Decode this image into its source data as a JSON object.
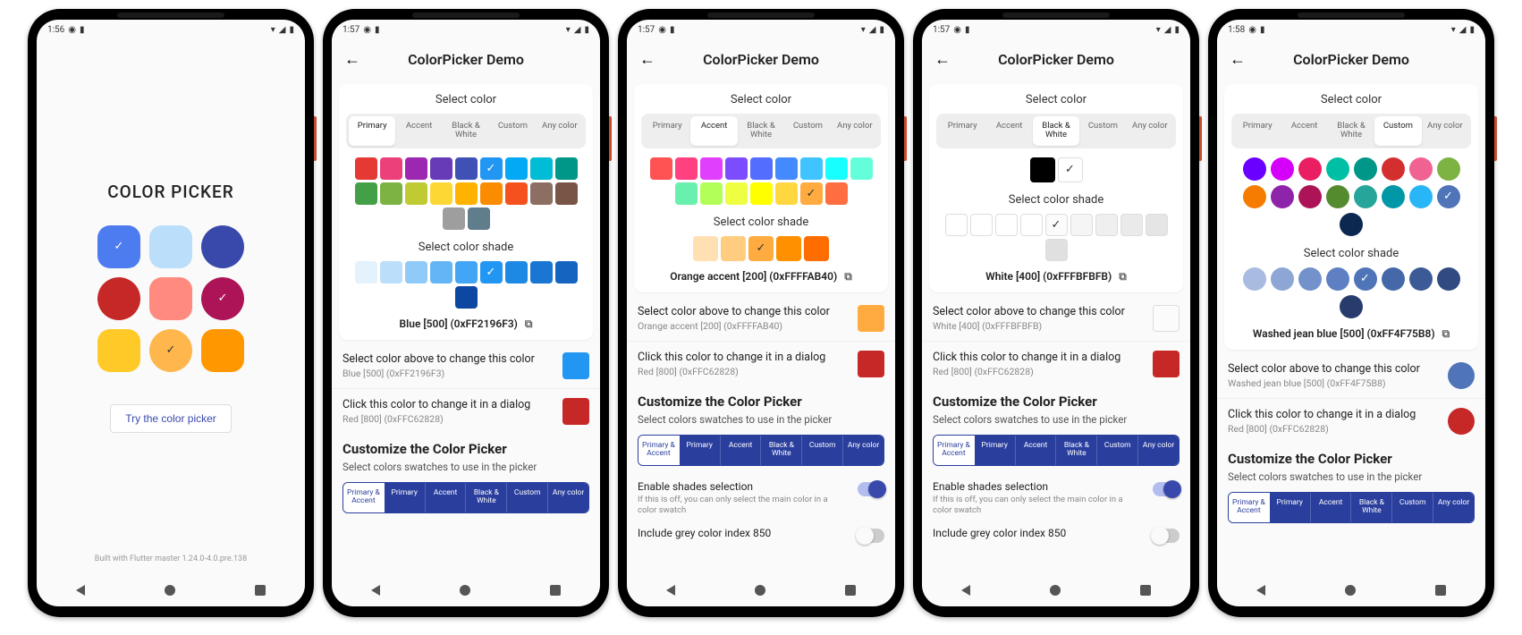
{
  "statusbar_times": [
    "1:56",
    "1:57",
    "1:57",
    "1:57",
    "1:58"
  ],
  "appbar": {
    "title": "ColorPicker Demo"
  },
  "home": {
    "title": "COLOR PICKER",
    "button": "Try the color picker",
    "footer": "Built with Flutter master 1.24.0-4.0.pre.138",
    "swatches": [
      {
        "color": "#4d7cf0",
        "shape": "rounded",
        "check": "light",
        "selected": true
      },
      {
        "color": "#bbdefb",
        "shape": "rounded"
      },
      {
        "color": "#3949ab",
        "shape": "circle"
      },
      {
        "color": "#c62828",
        "shape": "circle"
      },
      {
        "color": "#ff8a80",
        "shape": "rounded"
      },
      {
        "color": "#ad1457",
        "shape": "circle",
        "check": "light",
        "selected": true
      },
      {
        "color": "#ffca28",
        "shape": "rounded"
      },
      {
        "color": "#ffb74d",
        "shape": "circle",
        "check": "dark",
        "selected": true
      },
      {
        "color": "#ff9800",
        "shape": "rounded"
      }
    ]
  },
  "tabs": [
    "Primary",
    "Accent",
    "Black & White",
    "Custom",
    "Any color"
  ],
  "segments": [
    "Primary & Accent",
    "Primary",
    "Accent",
    "Black & White",
    "Custom",
    "Any color"
  ],
  "screen2": {
    "select_color": "Select color",
    "select_shade": "Select color shade",
    "active_tab": 0,
    "colors": [
      "#e53935",
      "#ec407a",
      "#9c27b0",
      "#673ab7",
      "#3f51b5",
      "#2196f3",
      "#03a9f4",
      "#00bcd4",
      "#009688",
      "#43a047",
      "#7cb342",
      "#c0ca33",
      "#fdd835",
      "#ffb300",
      "#fb8c00",
      "#f4511e",
      "#8d6e63",
      "#795548",
      "#9e9e9e",
      "#607d8b"
    ],
    "selected_color_index": 5,
    "shades": [
      "#e3f2fd",
      "#bbdefb",
      "#90caf9",
      "#64b5f6",
      "#42a5f5",
      "#2196f3",
      "#1e88e5",
      "#1976d2",
      "#1565c0",
      "#0d47a1"
    ],
    "selected_shade_index": 5,
    "result": "Blue [500] (0xFF2196F3)",
    "row1_title": "Select color above to change this color",
    "row1_sub": "Blue [500] (0xFF2196F3)",
    "row1_color": "#2196f3",
    "row2_title": "Click this color to change it in a dialog",
    "row2_sub": "Red [800] (0xFFC62828)",
    "row2_color": "#c62828",
    "customize_head": "Customize the Color Picker",
    "customize_sub": "Select colors swatches to use in the picker"
  },
  "screen3": {
    "active_tab": 1,
    "colors": [
      "#ff5252",
      "#ff4081",
      "#e040fb",
      "#7c4dff",
      "#536dfe",
      "#448aff",
      "#40c4ff",
      "#18ffff",
      "#64ffda",
      "#69f0ae",
      "#b2ff59",
      "#eeff41",
      "#ffff00",
      "#ffd740",
      "#ffab40",
      "#ff6e40"
    ],
    "selected_color_index": 14,
    "shades": [
      "#ffe0b2",
      "#ffcc80",
      "#ffab40",
      "#ff9100",
      "#ff6d00"
    ],
    "selected_shade_start": 0,
    "selected_shade_index": 2,
    "result": "Orange accent [200] (0xFFFFAB40)",
    "row1_sub": "Orange accent [200] (0xFFFFAB40)",
    "row1_color": "#ffab40",
    "enable_shades_title": "Enable shades selection",
    "enable_shades_sub": "If this is off, you can only select the main color in a color swatch",
    "include_grey": "Include grey color index 850"
  },
  "screen4": {
    "active_tab": 2,
    "bw": [
      {
        "c": "#000000"
      },
      {
        "c": "#ffffff",
        "bordered": true
      }
    ],
    "bw_selected": 1,
    "shades": [
      "#ffffff",
      "#ffffff",
      "#ffffff",
      "#ffffff",
      "#fbfbfb",
      "#f5f5f5",
      "#efefef",
      "#eaeaea",
      "#e5e5e5",
      "#e0e0e0"
    ],
    "selected_shade_index": 4,
    "result": "White [400] (0xFFFBFBFB)",
    "row1_sub": "White [400] (0xFFFBFBFB)",
    "row1_color": "#fbfbfb"
  },
  "screen5": {
    "active_tab": 3,
    "colors": [
      "#6a00ff",
      "#d500f9",
      "#e91e63",
      "#00bfa5",
      "#009688",
      "#d32f2f",
      "#f06292",
      "#7cb342",
      "#f57c00",
      "#8e24aa",
      "#ad1457",
      "#558b2f",
      "#26a69a",
      "#0097a7",
      "#29b6f6",
      "#4f75b8",
      "#0d2850"
    ],
    "selected_color_index": 15,
    "shades": [
      "#a9bbe0",
      "#8ea6d6",
      "#7391cb",
      "#5e80c2",
      "#4f75b8",
      "#4568a8",
      "#3b5a96",
      "#314b82",
      "#273c6d"
    ],
    "selected_shade_index": 4,
    "result": "Washed jean blue [500] (0xFF4F75B8)",
    "row1_sub": "Washed jean blue [500] (0xFF4F75B8)",
    "row1_color": "#4f75b8"
  }
}
